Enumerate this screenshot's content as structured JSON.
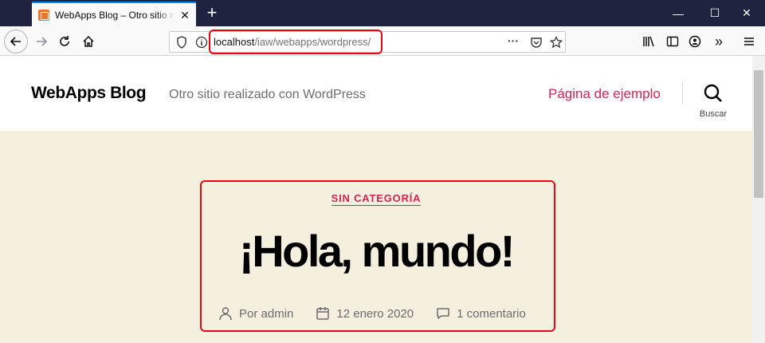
{
  "browser": {
    "tab_title": "WebApps Blog – Otro sitio realizado con WordPress",
    "url_host": "localhost",
    "url_path": "/iaw/webapps/wordpress/",
    "icons": {
      "back": "back-arrow-icon",
      "forward": "forward-arrow-icon",
      "reload": "reload-icon",
      "home": "home-icon",
      "tracking": "shield-icon",
      "info": "info-icon",
      "page_actions": "more-icon",
      "pocket": "pocket-icon",
      "bookmark": "star-icon",
      "library": "library-icon",
      "sidebar": "sidebar-icon",
      "account": "account-icon",
      "overflow": "chevron-double-right-icon",
      "menu": "hamburger-icon"
    }
  },
  "site": {
    "title": "WebApps Blog",
    "description": "Otro sitio realizado con WordPress",
    "menu_item": "Página de ejemplo",
    "search_label": "Buscar"
  },
  "post": {
    "category": "SIN CATEGORÍA",
    "title": "¡Hola, mundo!",
    "author": "Por admin",
    "date": "12 enero 2020",
    "comments": "1 comentario"
  },
  "colors": {
    "accent": "#cd2653",
    "highlight": "#e30613",
    "page_bg": "#f5efe0"
  }
}
